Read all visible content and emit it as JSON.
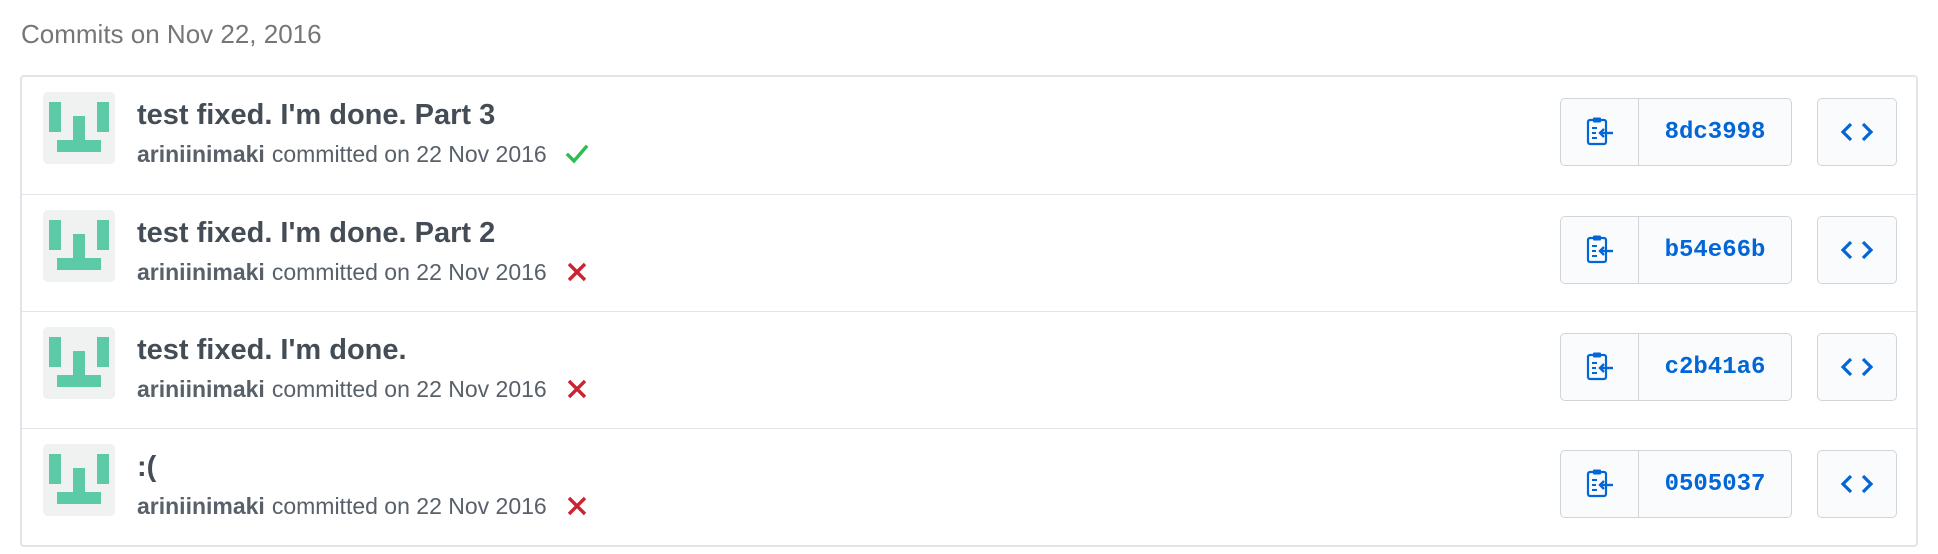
{
  "heading": "Commits on Nov 22, 2016",
  "colors": {
    "success": "#2cbe4e",
    "failure": "#cb2431",
    "link": "#0366d6",
    "avatar": "#5cc9a7"
  },
  "commits": [
    {
      "title": "test fixed. I'm done. Part 3",
      "author": "ariniinimaki",
      "meta": "committed on 22 Nov 2016",
      "status": "success",
      "status_icon": "check-icon",
      "sha": "8dc3998"
    },
    {
      "title": "test fixed. I'm done. Part 2",
      "author": "ariniinimaki",
      "meta": "committed on 22 Nov 2016",
      "status": "failure",
      "status_icon": "x-icon",
      "sha": "b54e66b"
    },
    {
      "title": "test fixed. I'm done.",
      "author": "ariniinimaki",
      "meta": "committed on 22 Nov 2016",
      "status": "failure",
      "status_icon": "x-icon",
      "sha": "c2b41a6"
    },
    {
      "title": ":(",
      "author": "ariniinimaki",
      "meta": "committed on 22 Nov 2016",
      "status": "failure",
      "status_icon": "x-icon",
      "sha": "0505037"
    }
  ]
}
